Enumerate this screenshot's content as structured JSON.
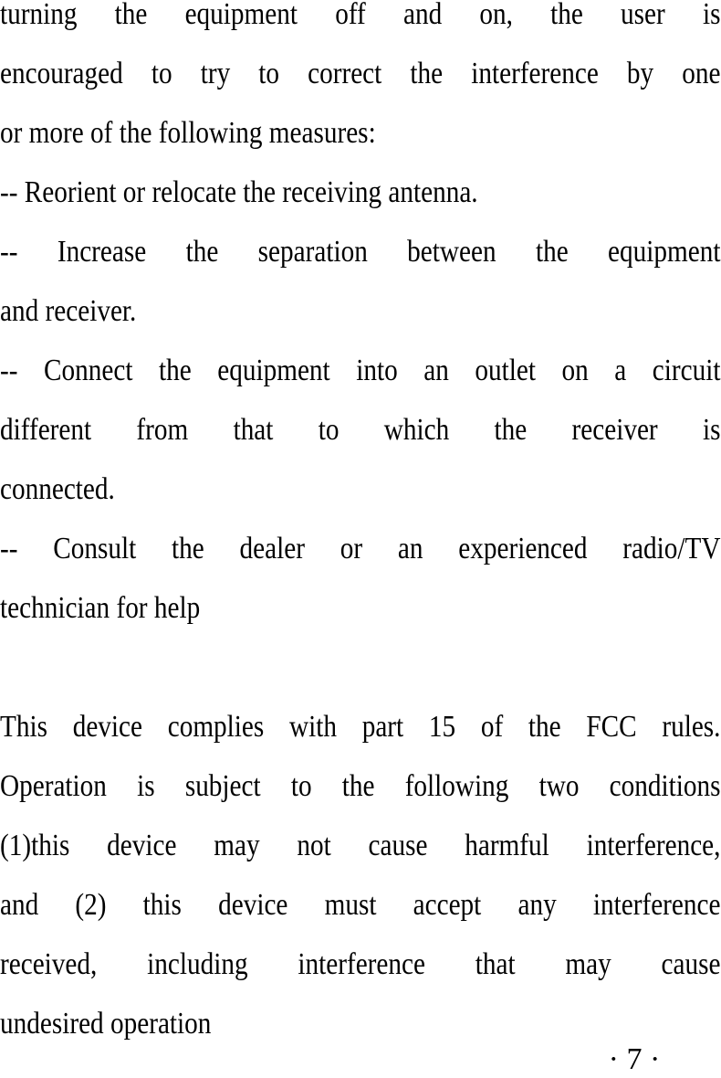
{
  "lines": [
    {
      "text": "turning the equipment off and on, the user is",
      "justify": true
    },
    {
      "text": "encouraged to try to correct the interference by one",
      "justify": true
    },
    {
      "text": "or more of the following measures:",
      "justify": false
    },
    {
      "text": "-- Reorient or relocate the receiving antenna.",
      "justify": false
    },
    {
      "text": "-- Increase the separation between the equipment",
      "justify": true
    },
    {
      "text": "and receiver.",
      "justify": false
    },
    {
      "text": "-- Connect the equipment into an outlet on a circuit",
      "justify": true
    },
    {
      "text": "different from that to which the receiver is",
      "justify": true
    },
    {
      "text": "connected.",
      "justify": false
    },
    {
      "text": "-- Consult the dealer or an experienced radio/TV",
      "justify": true
    },
    {
      "text": "technician for help",
      "justify": false
    },
    {
      "text": "This device complies with part 15 of the FCC rules.",
      "justify": true
    },
    {
      "text": "Operation is subject to the following two conditions",
      "justify": true
    },
    {
      "text": "(1)this device may not cause harmful interference,",
      "justify": true
    },
    {
      "text": "and (2) this device must accept any interference",
      "justify": true
    },
    {
      "text": "received, including interference that may cause",
      "justify": true
    },
    {
      "text": "undesired operation",
      "justify": false
    }
  ],
  "page_number": "· 7 ·"
}
